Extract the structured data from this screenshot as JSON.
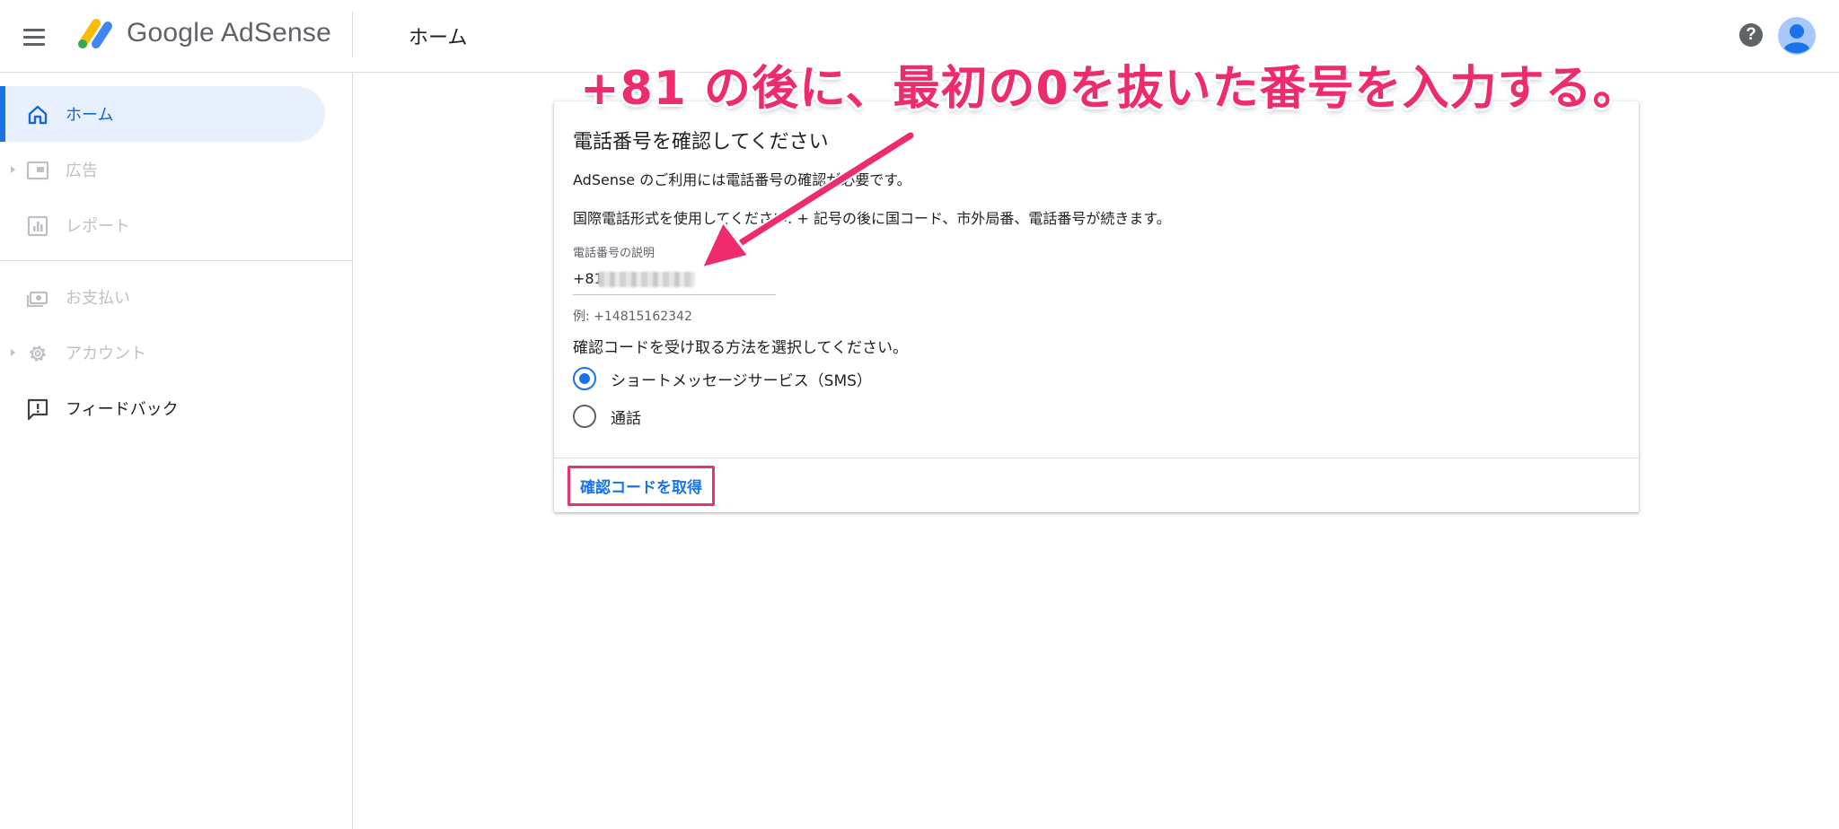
{
  "header": {
    "product_name": "Google AdSense",
    "page_title": "ホーム",
    "help_symbol": "?"
  },
  "sidebar": {
    "items": [
      {
        "label": "ホーム",
        "icon": "home-icon",
        "state": "active"
      },
      {
        "label": "広告",
        "icon": "ads-icon",
        "state": "disabled"
      },
      {
        "label": "レポート",
        "icon": "report-icon",
        "state": "disabled"
      },
      {
        "label": "お支払い",
        "icon": "payments-icon",
        "state": "disabled"
      },
      {
        "label": "アカウント",
        "icon": "gear-icon",
        "state": "disabled"
      },
      {
        "label": "フィードバック",
        "icon": "feedback-icon",
        "state": "normal"
      }
    ]
  },
  "card": {
    "title": "電話番号を確認してください",
    "description": "AdSense のご利用には電話番号の確認が必要です。",
    "format_instruction": "国際電話形式を使用してください: + 記号の後に国コード、市外局番、電話番号が続きます。",
    "phone_field_label": "電話番号の説明",
    "phone_value": "+81",
    "phone_hint": "例: +14815162342",
    "method_question": "確認コードを受け取る方法を選択してください。",
    "methods": [
      {
        "label": "ショートメッセージサービス（SMS）",
        "selected": true
      },
      {
        "label": "通話",
        "selected": false
      }
    ],
    "submit_label": "確認コードを取得"
  },
  "annotation": {
    "text": "+81 の後に、最初の0を抜いた番号を入力する。"
  },
  "colors": {
    "accent": "#1a73e8",
    "active_bg": "#e8f0fe",
    "annotation": "#ee2b6c",
    "divider": "#dadce0"
  }
}
